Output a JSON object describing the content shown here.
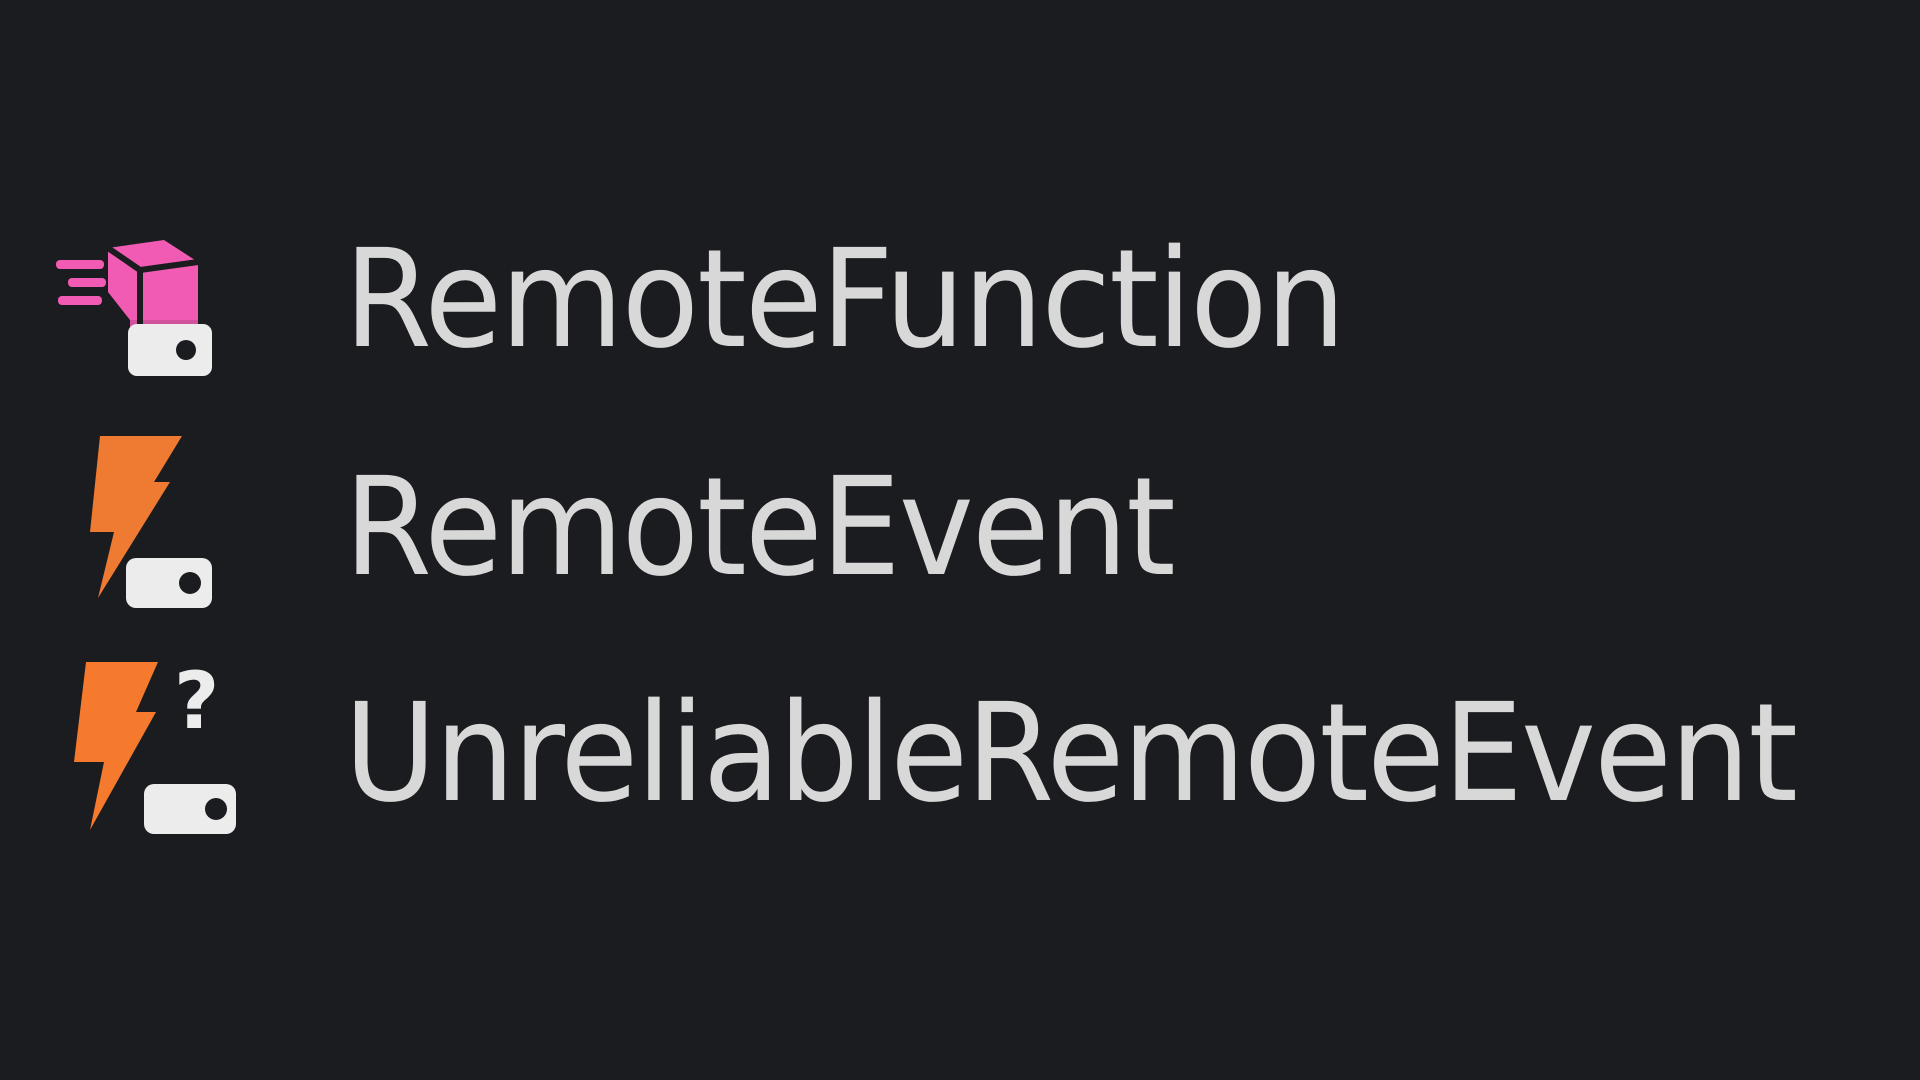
{
  "colors": {
    "background": "#1b1c20",
    "text": "#d8d8d8",
    "remote_function_accent": "#f25bb3",
    "remote_event_accent": "#ef7a31",
    "unreliable_remote_event_accent": "#f57a2d",
    "badge": "#ececec"
  },
  "items": [
    {
      "label": "RemoteFunction",
      "icon": "remote-function-icon"
    },
    {
      "label": "RemoteEvent",
      "icon": "remote-event-icon"
    },
    {
      "label": "UnreliableRemoteEvent",
      "icon": "unreliable-remote-event-icon"
    }
  ]
}
